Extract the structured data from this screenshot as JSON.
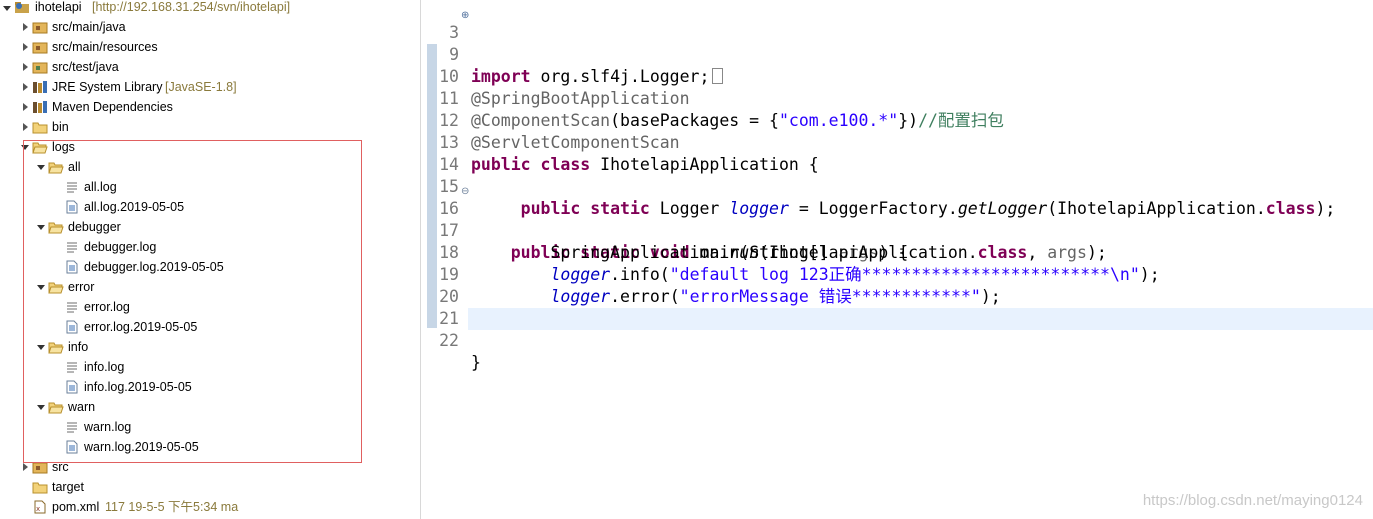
{
  "tree": {
    "project": {
      "name": "ihotelapi",
      "repo": "[http://192.168.31.254/svn/ihotelapi]"
    },
    "items": [
      {
        "label": "src/main/java"
      },
      {
        "label": "src/main/resources"
      },
      {
        "label": "src/test/java"
      },
      {
        "label": "JRE System Library",
        "decoration": "[JavaSE-1.8]"
      },
      {
        "label": "Maven Dependencies"
      },
      {
        "label": "bin"
      },
      {
        "label": "logs"
      },
      {
        "label": "all"
      },
      {
        "label": "all.log"
      },
      {
        "label": "all.log.2019-05-05"
      },
      {
        "label": "debugger"
      },
      {
        "label": "debugger.log"
      },
      {
        "label": "debugger.log.2019-05-05"
      },
      {
        "label": "error"
      },
      {
        "label": "error.log"
      },
      {
        "label": "error.log.2019-05-05"
      },
      {
        "label": "info"
      },
      {
        "label": "info.log"
      },
      {
        "label": "info.log.2019-05-05"
      },
      {
        "label": "warn"
      },
      {
        "label": "warn.log"
      },
      {
        "label": "warn.log.2019-05-05"
      },
      {
        "label": "src"
      },
      {
        "label": "target"
      },
      {
        "label": "pom.xml",
        "decoration": "117  19-5-5 下午5:34  ma"
      }
    ]
  },
  "editor": {
    "lines": [
      {
        "num": "3",
        "parts": [
          "import",
          " org.slf4j.Logger;"
        ]
      },
      {
        "num": "9",
        "parts": []
      },
      {
        "num": "10",
        "parts": [
          "@SpringBootApplication"
        ]
      },
      {
        "num": "11",
        "parts": [
          "@ComponentScan",
          "(basePackages = {",
          "\"com.e100.*\"",
          "})",
          "//配置扫包"
        ]
      },
      {
        "num": "12",
        "parts": [
          "@ServletComponentScan"
        ]
      },
      {
        "num": "13",
        "parts": [
          "public",
          " ",
          "class",
          " IhotelapiApplication {"
        ]
      },
      {
        "num": "14",
        "parts": []
      },
      {
        "num": "15",
        "parts": [
          "     ",
          "public",
          " ",
          "static",
          " Logger ",
          "logger",
          " = LoggerFactory.",
          "getLogger",
          "(IhotelapiApplication.",
          "class",
          ");"
        ]
      },
      {
        "num": "16",
        "parts": [
          "    ",
          "public",
          " ",
          "static",
          " ",
          "void",
          " main(String[] ",
          "args",
          ") {"
        ]
      },
      {
        "num": "17",
        "parts": [
          "        SpringApplication.",
          "run",
          "(IhotelapiApplication.",
          "class",
          ", ",
          "args",
          ");"
        ]
      },
      {
        "num": "18",
        "parts": [
          "        ",
          "logger",
          ".info(",
          "\"default log 123正确*************************\\n\"",
          ");"
        ]
      },
      {
        "num": "19",
        "parts": [
          "        ",
          "logger",
          ".error(",
          "\"errorMessage 错误************\"",
          ");"
        ]
      },
      {
        "num": "20",
        "parts": [
          "    }"
        ]
      },
      {
        "num": "21",
        "parts": []
      },
      {
        "num": "22",
        "parts": [
          "}"
        ]
      }
    ]
  },
  "watermark": "https://blog.csdn.net/maying0124",
  "colors": {
    "keyword": "#7f0055",
    "annotation": "#646464",
    "string": "#2a00ff",
    "comment": "#3f7f5f",
    "field": "#0000c0",
    "highlight": "#e8f2fe",
    "selection-box": "#e06060"
  }
}
